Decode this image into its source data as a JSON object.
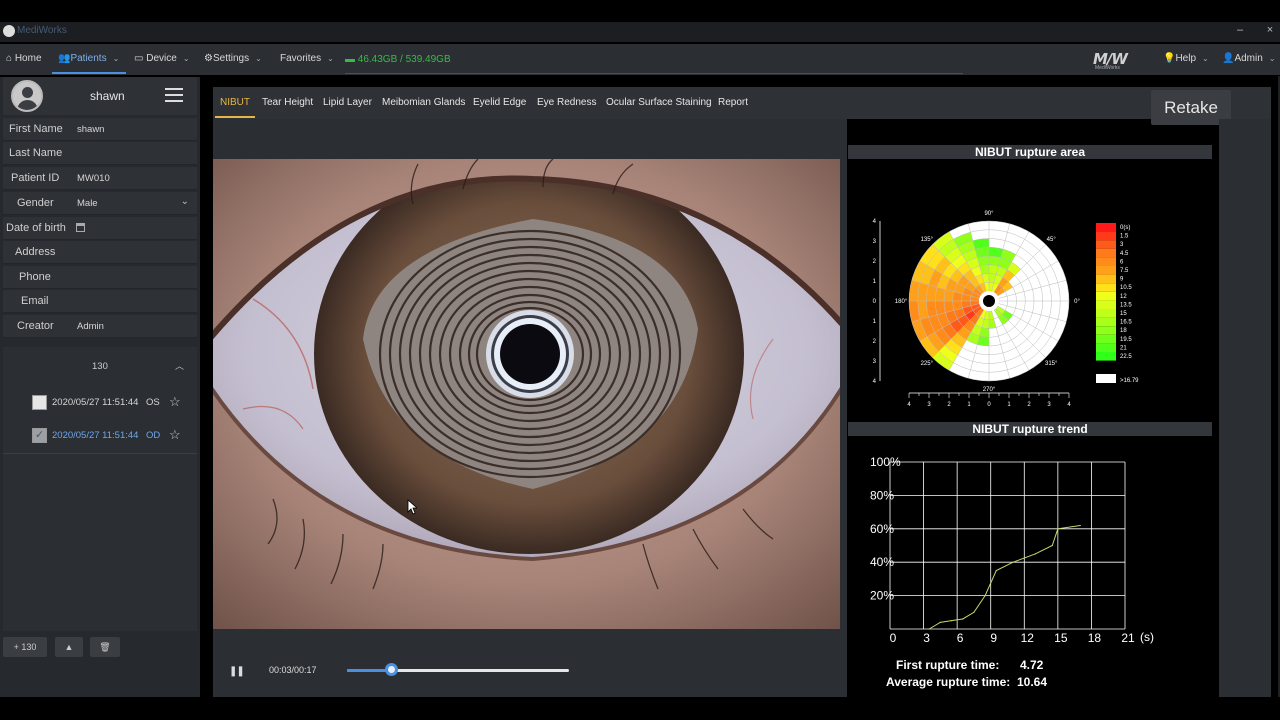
{
  "window": {
    "title": "MediWorks",
    "minimize": "–",
    "close": "×"
  },
  "menu": {
    "home": "Home",
    "patients": "Patients",
    "device": "Device",
    "settings": "Settings",
    "favorites": "Favorites",
    "storage": "46.43GB / 539.49GB",
    "help": "Help",
    "admin": "Admin",
    "logo_text": "MediWorks"
  },
  "patient": {
    "username": "shawn",
    "fields": [
      {
        "label": "First Name",
        "value": "shawn"
      },
      {
        "label": "Last Name",
        "value": ""
      },
      {
        "label": "Patient ID",
        "value": "MW010"
      },
      {
        "label": "Gender",
        "value": "Male"
      },
      {
        "label": "Date of birth",
        "value": ""
      },
      {
        "label": "Address",
        "value": ""
      },
      {
        "label": "Phone",
        "value": ""
      },
      {
        "label": "Email",
        "value": ""
      },
      {
        "label": "Creator",
        "value": "Admin"
      }
    ]
  },
  "records": {
    "count": "130",
    "items": [
      {
        "datetime": "2020/05/27 11:51:44",
        "eye": "OS",
        "checked": false
      },
      {
        "datetime": "2020/05/27 11:51:44",
        "eye": "OD",
        "checked": true
      }
    ],
    "add_button": "+ 130",
    "up_button": "▲",
    "delete_button": "🗑"
  },
  "tabs": [
    "NIBUT",
    "Tear Height",
    "Lipid Layer",
    "Meibomian Glands",
    "Eyelid Edge",
    "Eye Redness",
    "Ocular Surface Staining",
    "Report"
  ],
  "retake_label": "Retake",
  "player": {
    "time": "00:03/00:17",
    "progress": 0.2
  },
  "rupture_area": {
    "title": "NIBUT rupture area",
    "scale_labels": [
      "0(s)",
      "1.5",
      "3",
      "4.5",
      "6",
      "7.5",
      "9",
      "10.5",
      "12",
      "13.5",
      "15",
      "16.5",
      "18",
      "19.5",
      "21",
      "22.5"
    ],
    "scale_colors": [
      "#ff1a1a",
      "#ff3a1a",
      "#ff5a1a",
      "#ff7a1a",
      "#ff8c1a",
      "#ffa01a",
      "#ffc01a",
      "#ffe01a",
      "#f0ff1a",
      "#d8ff1a",
      "#c0ff1a",
      "#a8ff1a",
      "#90ff1a",
      "#70ff1a",
      "#50ff1a",
      "#30ff1a"
    ],
    "white_label": ">16.79",
    "angle_labels": [
      "90°",
      "45°",
      "0°",
      "315°",
      "270°",
      "225°",
      "180°",
      "135°"
    ],
    "axis_ticks": [
      "4",
      "3",
      "2",
      "1",
      "0",
      "1",
      "2",
      "3",
      "4"
    ]
  },
  "rupture_trend": {
    "title": "NIBUT rupture trend",
    "chart_data": {
      "type": "line",
      "x": [
        3.5,
        4.5,
        5.5,
        6.5,
        7.5,
        8.5,
        9.5,
        11,
        13,
        14.5,
        15,
        17
      ],
      "y": [
        0,
        4,
        5,
        6,
        10,
        20,
        35,
        40,
        45,
        50,
        60,
        62
      ],
      "xticks": [
        "0",
        "3",
        "6",
        "9",
        "12",
        "15",
        "18",
        "21"
      ],
      "yticks": [
        "100%",
        "80%",
        "60%",
        "40%",
        "20%"
      ],
      "xunit": "(s)",
      "xlim": [
        0,
        21
      ],
      "ylim": [
        0,
        100
      ],
      "grid": true,
      "line_color": "#c8d86a"
    },
    "first_label": "First rupture time:",
    "first_value": "4.72",
    "avg_label": "Average rupture time:",
    "avg_value": "10.64"
  }
}
